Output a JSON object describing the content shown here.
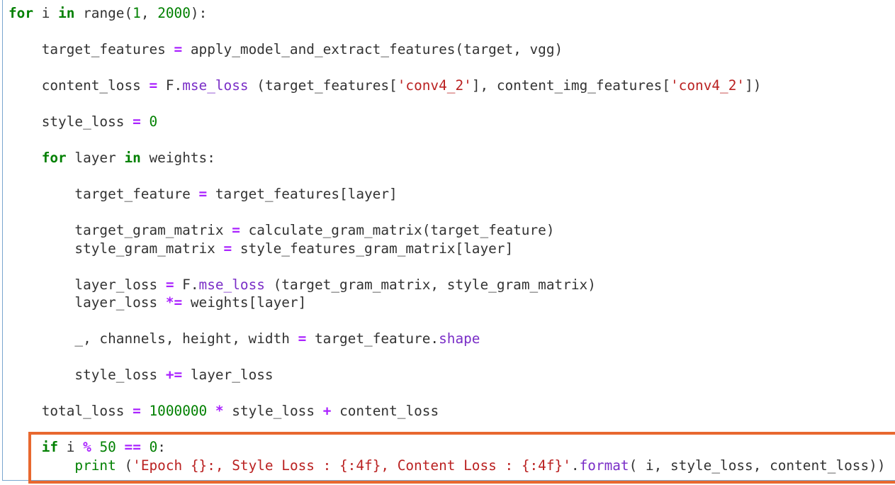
{
  "highlight_color": "#e8682f",
  "code_lines": [
    [
      [
        "for",
        "kw"
      ],
      [
        " i ",
        ""
      ],
      [
        "in",
        "kw"
      ],
      [
        " range(",
        ""
      ],
      [
        "1",
        "num"
      ],
      [
        ", ",
        ""
      ],
      [
        "2000",
        "num"
      ],
      [
        "):",
        ""
      ]
    ],
    [],
    [
      [
        "    target_features ",
        ""
      ],
      [
        "=",
        "op"
      ],
      [
        " apply_model_and_extract_features(target, vgg)",
        ""
      ]
    ],
    [],
    [
      [
        "    content_loss ",
        ""
      ],
      [
        "=",
        "op"
      ],
      [
        " F.",
        ""
      ],
      [
        "mse_loss",
        "attr"
      ],
      [
        " (target_features[",
        ""
      ],
      [
        "'conv4_2'",
        "str"
      ],
      [
        "], content_img_features[",
        ""
      ],
      [
        "'conv4_2'",
        "str"
      ],
      [
        "])",
        ""
      ]
    ],
    [],
    [
      [
        "    style_loss ",
        ""
      ],
      [
        "=",
        "op"
      ],
      [
        " ",
        ""
      ],
      [
        "0",
        "num"
      ]
    ],
    [],
    [
      [
        "    ",
        ""
      ],
      [
        "for",
        "kw"
      ],
      [
        " layer ",
        ""
      ],
      [
        "in",
        "kw"
      ],
      [
        " weights:",
        ""
      ]
    ],
    [],
    [
      [
        "        target_feature ",
        ""
      ],
      [
        "=",
        "op"
      ],
      [
        " target_features[layer]",
        ""
      ]
    ],
    [],
    [
      [
        "        target_gram_matrix ",
        ""
      ],
      [
        "=",
        "op"
      ],
      [
        " calculate_gram_matrix(target_feature)",
        ""
      ]
    ],
    [
      [
        "        style_gram_matrix ",
        ""
      ],
      [
        "=",
        "op"
      ],
      [
        " style_features_gram_matrix[layer]",
        ""
      ]
    ],
    [],
    [
      [
        "        layer_loss ",
        ""
      ],
      [
        "=",
        "op"
      ],
      [
        " F.",
        ""
      ],
      [
        "mse_loss",
        "attr"
      ],
      [
        " (target_gram_matrix, style_gram_matrix)",
        ""
      ]
    ],
    [
      [
        "        layer_loss ",
        ""
      ],
      [
        "*=",
        "op"
      ],
      [
        " weights[layer]",
        ""
      ]
    ],
    [],
    [
      [
        "        _, channels, height, width ",
        ""
      ],
      [
        "=",
        "op"
      ],
      [
        " target_feature.",
        ""
      ],
      [
        "shape",
        "attr"
      ]
    ],
    [],
    [
      [
        "        style_loss ",
        ""
      ],
      [
        "+=",
        "op"
      ],
      [
        " layer_loss",
        ""
      ]
    ],
    [],
    [
      [
        "    total_loss ",
        ""
      ],
      [
        "=",
        "op"
      ],
      [
        " ",
        ""
      ],
      [
        "1000000",
        "num"
      ],
      [
        " ",
        ""
      ],
      [
        "*",
        "op"
      ],
      [
        " style_loss ",
        ""
      ],
      [
        "+",
        "op"
      ],
      [
        " content_loss",
        ""
      ]
    ],
    [],
    [
      [
        "    ",
        ""
      ],
      [
        "if",
        "kw"
      ],
      [
        " i ",
        ""
      ],
      [
        "%",
        "op"
      ],
      [
        " ",
        ""
      ],
      [
        "50",
        "num"
      ],
      [
        " ",
        ""
      ],
      [
        "==",
        "op"
      ],
      [
        " ",
        ""
      ],
      [
        "0",
        "num"
      ],
      [
        ":",
        ""
      ]
    ],
    [
      [
        "        ",
        ""
      ],
      [
        "print",
        "bi"
      ],
      [
        " (",
        ""
      ],
      [
        "'Epoch {}:, Style Loss : {:4f}, Content Loss : {:4f}'",
        "str"
      ],
      [
        ".",
        ""
      ],
      [
        "format",
        "attr"
      ],
      [
        "( i, style_loss, content_loss))",
        ""
      ]
    ]
  ]
}
